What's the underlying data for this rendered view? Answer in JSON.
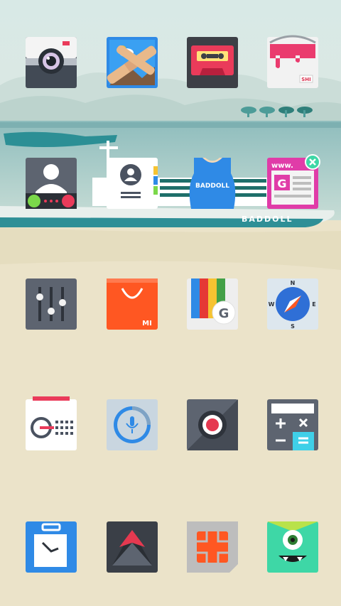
{
  "wallpaper": {
    "ship_brand": "BADDOLL",
    "shirt_brand": "BADDOLL"
  },
  "home": {
    "rows": [
      [
        {
          "name": "camera-icon"
        },
        {
          "name": "gallery-icon"
        },
        {
          "name": "music-cassette-icon"
        },
        {
          "name": "theme-paint-bucket-icon",
          "badge_text": "SHI"
        }
      ],
      [
        {
          "name": "phone-dialer-icon"
        },
        {
          "name": "contacts-icon"
        },
        {
          "name": "baddoll-shirt-icon"
        },
        {
          "name": "browser-icon",
          "text": "www."
        }
      ],
      [
        {
          "name": "settings-sliders-icon"
        },
        {
          "name": "mi-store-bag-icon",
          "text": "MI"
        },
        {
          "name": "google-icon"
        },
        {
          "name": "compass-icon",
          "dirs": [
            "N",
            "E",
            "S",
            "W"
          ]
        }
      ],
      [
        {
          "name": "radio-icon"
        },
        {
          "name": "voice-assistant-icon"
        },
        {
          "name": "recorder-icon"
        },
        {
          "name": "calculator-icon"
        }
      ],
      [
        {
          "name": "clock-icon"
        },
        {
          "name": "dark-app-icon"
        },
        {
          "name": "sim-toolkit-icon"
        },
        {
          "name": "monster-icon"
        }
      ]
    ]
  }
}
